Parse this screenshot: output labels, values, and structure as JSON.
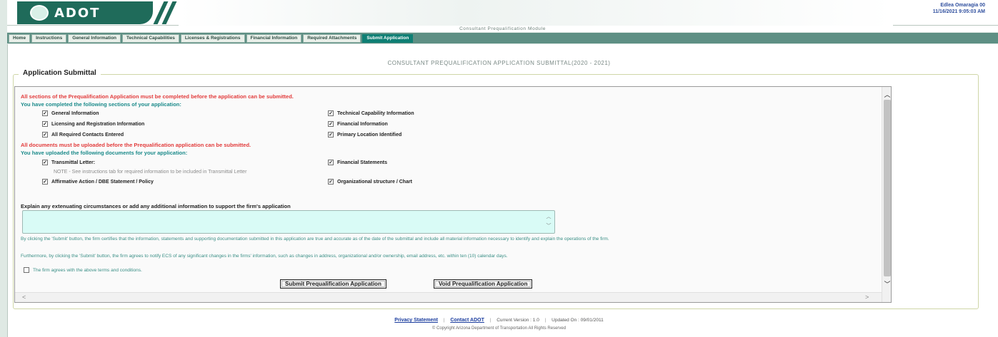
{
  "header": {
    "logo_text": "ADOT",
    "user_name": "Edlea Omaragia 00",
    "timestamp": "11/16/2021 9:05:03 AM",
    "module_title": "Consultant Prequalification Module"
  },
  "tabs": [
    {
      "label": "Home",
      "active": false
    },
    {
      "label": "Instructions",
      "active": false
    },
    {
      "label": "General Information",
      "active": false
    },
    {
      "label": "Technical Capabilities",
      "active": false
    },
    {
      "label": "Licenses & Registrations",
      "active": false
    },
    {
      "label": "Financial Information",
      "active": false
    },
    {
      "label": "Required Attachments",
      "active": false
    },
    {
      "label": "Submit Application",
      "active": true
    }
  ],
  "page_title": "CONSULTANT PREQUALIFICATION APPLICATION SUBMITTAL(2020 - 2021)",
  "fieldset_legend": "Application Submittal",
  "sections": {
    "warning": "All sections of the Prequalification Application must be completed before the application can be submitted.",
    "completed_heading": "You have completed the following sections of your application:",
    "items": [
      {
        "label": "General Information",
        "checked": true
      },
      {
        "label": "Technical Capability Information",
        "checked": true
      },
      {
        "label": "Licensing and Registration Information",
        "checked": true
      },
      {
        "label": "Financial Information",
        "checked": true
      },
      {
        "label": "All Required Contacts Entered",
        "checked": true
      },
      {
        "label": "Primary Location Identified",
        "checked": true
      }
    ]
  },
  "documents": {
    "warning": "All documents must be uploaded before the Prequalification application can be submitted.",
    "uploaded_heading": "You have uploaded the following documents for your application:",
    "items": [
      {
        "label": "Transmittal Letter:",
        "checked": true
      },
      {
        "label": "Financial Statements",
        "checked": true
      },
      {
        "label": "Affirmative Action / DBE Statement / Policy",
        "checked": true
      },
      {
        "label": "Organizational structure / Chart",
        "checked": true
      }
    ],
    "note": "NOTE - See instructions tab for required information to be included in Transmittal Letter"
  },
  "explain": {
    "label": "Explain any extenuating circumstances or add any additional information to support the firm's application",
    "value": ""
  },
  "legal": {
    "text1": "By clicking the 'Submit' button, the firm certifies that the information, statements and supporting documentation submitted in this application are true and accurate as of the date of the submittal and include all material information necessary to identify and explain the operations of the firm.",
    "text2": "Furthermore, by clicking the 'Submit' button, the firm agrees to notify ECS of any significant changes in the firms' information, such as changes in address, organizational and/or ownership, email address, etc. within ten (10) calendar days.",
    "agree_label": "The firm agrees with the above terms and conditions.",
    "agree_checked": false
  },
  "buttons": {
    "submit": "Submit Prequalification Application",
    "void": "Void Prequalification Application"
  },
  "footer": {
    "privacy": "Privacy Statement",
    "contact": "Contact ADOT",
    "version": "Current Version : 1.0",
    "updated": "Updated On : 09/01/2011",
    "copyright": "© Copyright Arizona Department of Transportation All Rights Reserved"
  },
  "colors": {
    "brand": "#1f6b5a",
    "tab_active": "#0e7f74",
    "warning": "#e23b3b",
    "heading": "#1a8a8a",
    "textarea_bg": "#d9fbf6"
  }
}
